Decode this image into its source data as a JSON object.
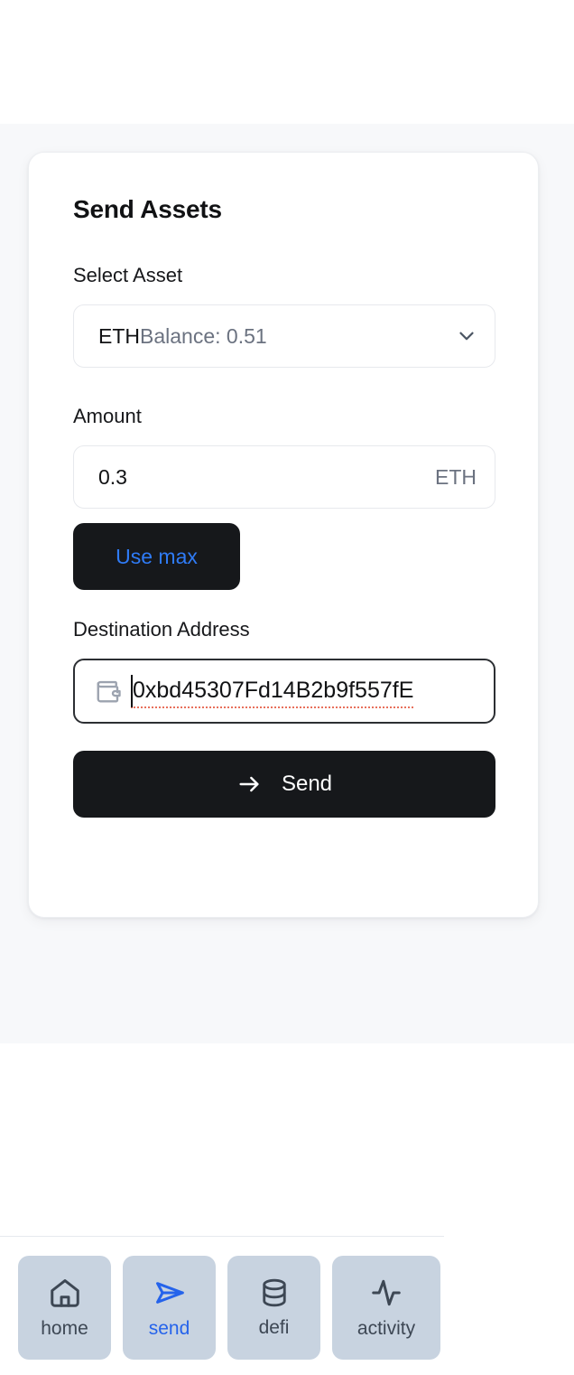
{
  "screen": {
    "background_color": "#ffffff",
    "content_background_color": "#f7f8fa"
  },
  "card": {
    "title": "Send Assets",
    "accent_color": "#2563eb",
    "dark_button_color": "#16181b",
    "asset": {
      "label": "Select Asset",
      "symbol": "ETH",
      "balance_text": "Balance: 0.51",
      "balance_value": "0.51",
      "chevron_icon": "chevron-down-icon"
    },
    "amount": {
      "label": "Amount",
      "value": "0.3",
      "unit": "ETH",
      "use_max_label": "Use max"
    },
    "destination": {
      "label": "Destination Address",
      "value": "0xbd45307Fd14B2b9f557fE",
      "wallet_icon": "wallet-icon",
      "spellcheck_underline_color": "#e8705c"
    },
    "submit": {
      "label": "Send",
      "icon": "arrow-right-icon"
    }
  },
  "bottom_nav": {
    "items": [
      {
        "id": "home",
        "label": "home",
        "icon": "home-icon",
        "active": false
      },
      {
        "id": "send",
        "label": "send",
        "icon": "paper-plane-icon",
        "active": true
      },
      {
        "id": "defi",
        "label": "defi",
        "icon": "database-icon",
        "active": false
      },
      {
        "id": "activity",
        "label": "activity",
        "icon": "activity-pulse-icon",
        "active": false
      }
    ]
  }
}
